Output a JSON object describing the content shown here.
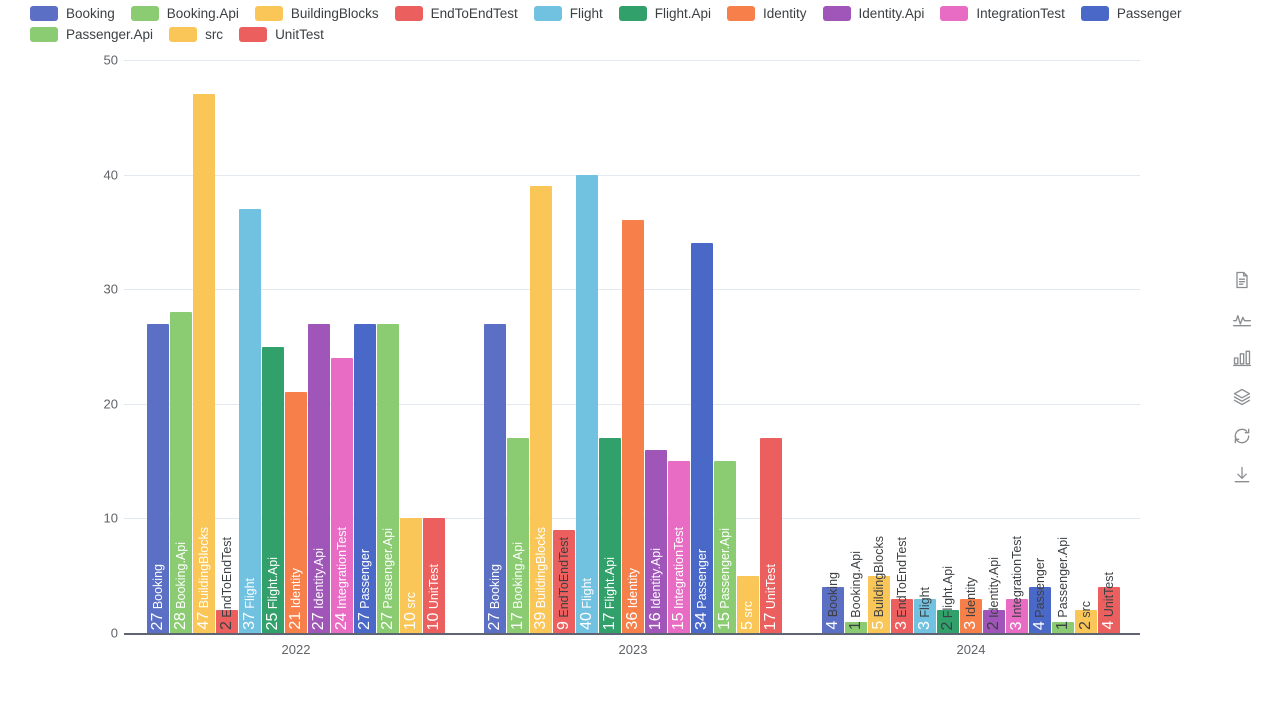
{
  "legend": {
    "items": [
      {
        "label": "Booking",
        "color": "#5b6fc4"
      },
      {
        "label": "Booking.Api",
        "color": "#8bcc72"
      },
      {
        "label": "BuildingBlocks",
        "color": "#fac657"
      },
      {
        "label": "EndToEndTest",
        "color": "#ec5f5f"
      },
      {
        "label": "Flight",
        "color": "#71c1e0"
      },
      {
        "label": "Flight.Api",
        "color": "#31a06b"
      },
      {
        "label": "Identity",
        "color": "#f77f4a"
      },
      {
        "label": "Identity.Api",
        "color": "#a055b8"
      },
      {
        "label": "IntegrationTest",
        "color": "#e86cc4"
      },
      {
        "label": "Passenger",
        "color": "#4a68c8"
      },
      {
        "label": "Passenger.Api",
        "color": "#8bcc72"
      },
      {
        "label": "src",
        "color": "#fac657"
      },
      {
        "label": "UnitTest",
        "color": "#ec5f5f"
      }
    ]
  },
  "toolbar": {
    "icons": [
      {
        "name": "document-icon",
        "title": "Data table"
      },
      {
        "name": "line-chart-icon",
        "title": "Line chart"
      },
      {
        "name": "bar-chart-icon",
        "title": "Bar chart"
      },
      {
        "name": "layers-icon",
        "title": "Stacked"
      },
      {
        "name": "refresh-icon",
        "title": "Refresh"
      },
      {
        "name": "download-icon",
        "title": "Download"
      }
    ]
  },
  "chart_data": {
    "type": "bar",
    "title": "",
    "xlabel": "",
    "ylabel": "",
    "ylim": [
      0,
      50
    ],
    "yticks": [
      0,
      10,
      20,
      30,
      40,
      50
    ],
    "grid": true,
    "legend_position": "top",
    "categories": [
      "2022",
      "2023",
      "2024"
    ],
    "series": [
      {
        "name": "Booking",
        "color": "#5b6fc4",
        "values": [
          27,
          27,
          4
        ]
      },
      {
        "name": "Booking.Api",
        "color": "#8bcc72",
        "values": [
          28,
          17,
          1
        ]
      },
      {
        "name": "BuildingBlocks",
        "color": "#fac657",
        "values": [
          47,
          39,
          5
        ]
      },
      {
        "name": "EndToEndTest",
        "color": "#ec5f5f",
        "values": [
          2,
          9,
          3
        ]
      },
      {
        "name": "Flight",
        "color": "#71c1e0",
        "values": [
          37,
          40,
          3
        ]
      },
      {
        "name": "Flight.Api",
        "color": "#31a06b",
        "values": [
          25,
          17,
          2
        ]
      },
      {
        "name": "Identity",
        "color": "#f77f4a",
        "values": [
          21,
          36,
          3
        ]
      },
      {
        "name": "Identity.Api",
        "color": "#a055b8",
        "values": [
          27,
          16,
          2
        ]
      },
      {
        "name": "IntegrationTest",
        "color": "#e86cc4",
        "values": [
          24,
          15,
          3
        ]
      },
      {
        "name": "Passenger",
        "color": "#4a68c8",
        "values": [
          27,
          34,
          4
        ]
      },
      {
        "name": "Passenger.Api",
        "color": "#8bcc72",
        "values": [
          27,
          15,
          1
        ]
      },
      {
        "name": "src",
        "color": "#fac657",
        "values": [
          10,
          5,
          2
        ]
      },
      {
        "name": "UnitTest",
        "color": "#ec5f5f",
        "values": [
          10,
          17,
          4
        ]
      }
    ]
  }
}
